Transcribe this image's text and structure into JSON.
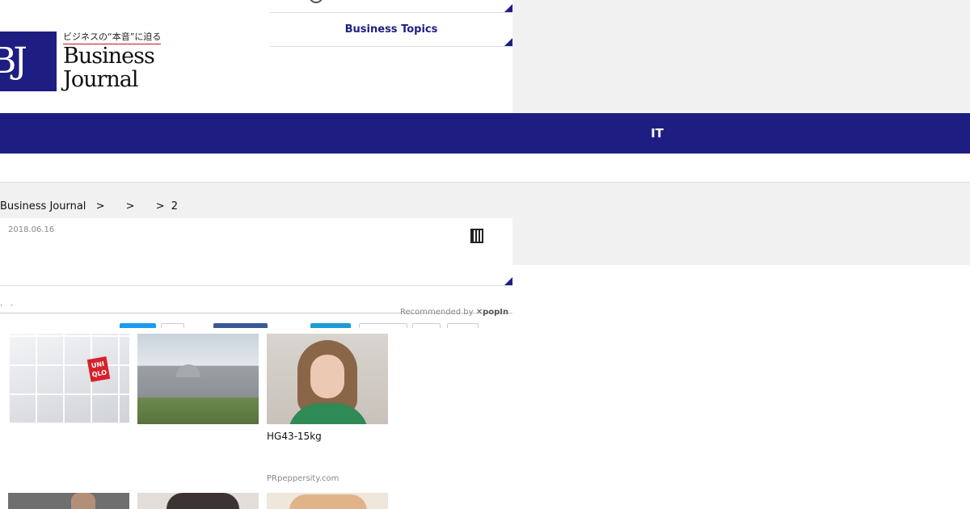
{
  "header": {
    "logo_mark": "BJ",
    "logo_tagline": "ビジネスの“本音”に迫る",
    "logo_word1": "Business",
    "logo_word2": "Journal",
    "top_link": "Business Topics"
  },
  "nav": {
    "items": [
      "IT"
    ]
  },
  "breadcrumb": {
    "home": "Business Journal",
    "sep1": ">",
    "sep2": ">",
    "sep3": ">",
    "page": "2"
  },
  "article": {
    "date": "2018.06.16",
    "tags": ",　,"
  },
  "recommend": {
    "label": "Recommended by",
    "provider": "popIn",
    "items": [
      {
        "image": "uniqlo-store-photo",
        "badge_line1": "UNI",
        "badge_line2": "QLO"
      },
      {
        "image": "building-photo"
      },
      {
        "image": "woman-portrait-photo",
        "caption": "HG43-15kg",
        "sponsor": "PRpeppersity.com"
      }
    ]
  },
  "colors": {
    "brand": "#1e1e82",
    "gray": "#f1f1f1",
    "uniqlo_red": "#d7202a"
  }
}
